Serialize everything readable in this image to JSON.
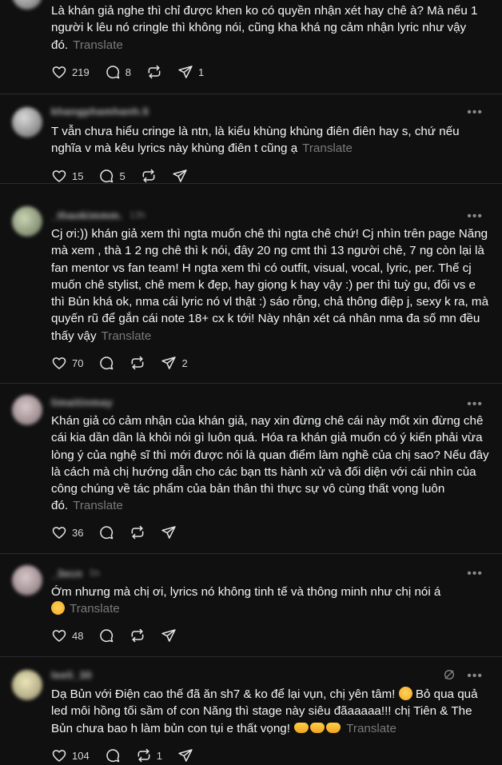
{
  "posts": [
    {
      "text": "Là khán giả nghe thì chỉ được khen ko có quyền nhận xét hay chê à? Mà nếu 1 người k lêu nó cringle thì không nói, cũng kha khá ng cảm nhận lyric như vậy đó.",
      "translate": "Translate",
      "likes": "219",
      "replies": "8",
      "reposts": "",
      "shares": "1"
    },
    {
      "username": "khangphamhanh.5",
      "time": "",
      "text": "T vẫn chưa hiểu cringe là ntn, là kiểu khùng khùng điên điên hay s, chứ nếu nghĩa v mà kêu lyrics này khùng điên t cũng ạ",
      "translate": "Translate",
      "likes": "15",
      "replies": "5",
      "reposts": "",
      "shares": ""
    },
    {
      "username": "_thaokimmm.",
      "time": "13h",
      "text": "Cj ơi:)) khán giả xem thì ngta muốn chê thì ngta chê chứ! Cj nhìn trên page Năng mà xem , thà 1 2 ng chê thì k nói, đây 20 ng cmt thì 13 người chê, 7 ng còn lại là fan mentor vs fan team! H ngta xem thì có outfit, visual, vocal, lyric, per. Thế cj muốn chê stylist, chê mem k đẹp, hay giọng k hay vậy :) per thì tuỳ gu, đối vs e thì Bủn khá ok, nma cái lyric nó vl thật :) sáo rỗng, chả thông điệp j, sexy k ra, mà quyến rũ để gắn cái note 18+ cx k tới! Này nhận xét cá nhân nma đa số mn đều thấy vậy",
      "translate": "Translate",
      "likes": "70",
      "replies": "",
      "reposts": "",
      "shares": "2"
    },
    {
      "username": "limaitinmay",
      "time": "",
      "text": "Khán giả có cảm nhận của khán giả, nay xin đừng chê cái này mốt xin đừng chê cái kia dần dần là khỏi nói gì luôn quá. Hóa ra khán giả muốn có ý kiến phải vừa lòng ý của nghệ sĩ thì mới được nói là quan điểm làm nghề của chị sao? Nếu đây là cách mà chị hướng dẫn cho các bạn tts hành xử và đối diện với cái nhìn của công chúng về tác phẩm của bản thân thì thực sự vô cùng thất vọng luôn đó.",
      "translate": "Translate",
      "likes": "36",
      "replies": "",
      "reposts": "",
      "shares": ""
    },
    {
      "username": "_3ecn",
      "time": "5h",
      "text": "Ớm nhưng mà chị ơi, lyrics nó không tinh tế và thông minh như chị nói á",
      "translate": "Translate",
      "likes": "48",
      "replies": "",
      "reposts": "",
      "shares": ""
    },
    {
      "username": "leeli_30",
      "time": "",
      "text": "Dạ Bủn với Điện cao thế đã ăn sh7 & ko để lại vụn, chị yên tâm!",
      "text2": "Bỏ qua quả led môi hồng tối sầm of con Năng thì stage này siêu đãaaaaa!!! chị Tiên & The Bủn chưa bao h làm bủn con tụi e thất vọng!",
      "translate": "Translate",
      "likes": "104",
      "replies": "",
      "reposts": "1",
      "shares": ""
    }
  ],
  "more_label": "•••",
  "icons": [
    "heart-icon",
    "comment-icon",
    "repost-icon",
    "share-icon",
    "more-icon",
    "mute-icon"
  ]
}
